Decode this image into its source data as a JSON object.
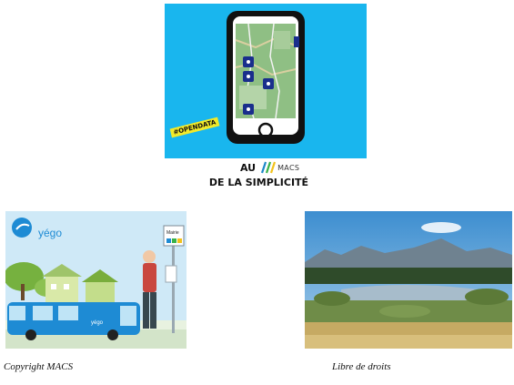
{
  "promo": {
    "tag": "#OPENDATA",
    "colors": {
      "background": "#19b6ee",
      "phone": "#111111",
      "map": "#8fbf84",
      "pin": "#1a2e8c",
      "tag": "#f1ea2a"
    }
  },
  "caption": {
    "line1_prefix": "AU",
    "logo_text": "MACS",
    "line2": "DE LA SIMPLICITÉ"
  },
  "bus_image": {
    "brand": "yégo",
    "stop_sign": "Mairie",
    "bus_brand": "yégo",
    "icons": [
      "brand-logo-icon",
      "bus-stop-icon",
      "bus-icon",
      "person-icon"
    ]
  },
  "landscape_image": {
    "icons": [
      "mountain-landscape-icon"
    ]
  },
  "credits": {
    "left": "Copyright MACS",
    "right": "Libre de droits"
  }
}
